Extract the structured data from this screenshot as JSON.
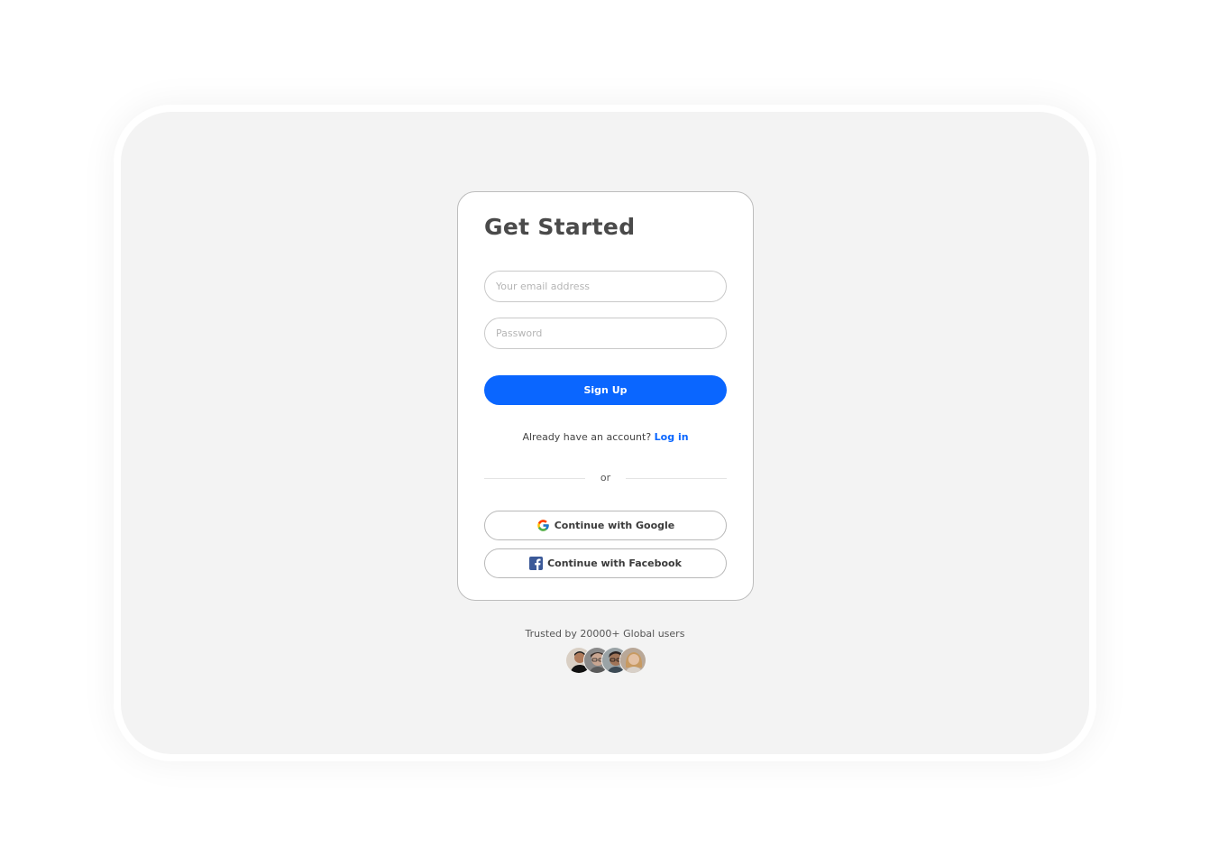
{
  "card": {
    "title": "Get Started",
    "email_placeholder": "Your email address",
    "password_placeholder": "Password",
    "signup_label": "Sign Up",
    "login_prompt": "Already have an account?",
    "login_link": "Log in",
    "divider": "or",
    "google_label": "Continue with Google",
    "facebook_label": "Continue with Facebook"
  },
  "footer": {
    "trusted_text": "Trusted by 20000+ Global users",
    "avatars": [
      "avatar-1",
      "avatar-2",
      "avatar-3",
      "avatar-4"
    ]
  },
  "colors": {
    "accent": "#0a66ff",
    "panel_bg": "#f3f3f3",
    "facebook": "#3b5998"
  },
  "icons": {
    "google": "google-icon",
    "facebook": "facebook-icon"
  }
}
